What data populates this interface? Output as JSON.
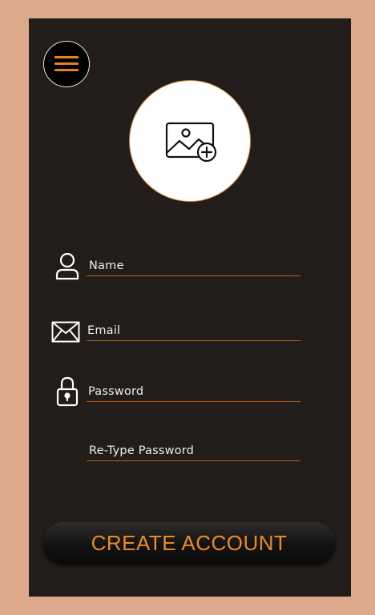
{
  "menu": {
    "icon": "hamburger-icon"
  },
  "avatar": {
    "icon": "add-image-icon"
  },
  "form": {
    "name_placeholder": "Name",
    "email_placeholder": "Email",
    "password_placeholder": "Password",
    "retype_placeholder": "Re-Type Password"
  },
  "icons": {
    "name": "user-icon",
    "email": "envelope-icon",
    "password": "lock-icon"
  },
  "actions": {
    "create_label": "CREATE ACCOUNT"
  },
  "colors": {
    "background": "#dca98a",
    "panel": "#221c1a",
    "accent": "#e67e22",
    "field_line": "#b5611d",
    "text": "#f1ece8"
  }
}
